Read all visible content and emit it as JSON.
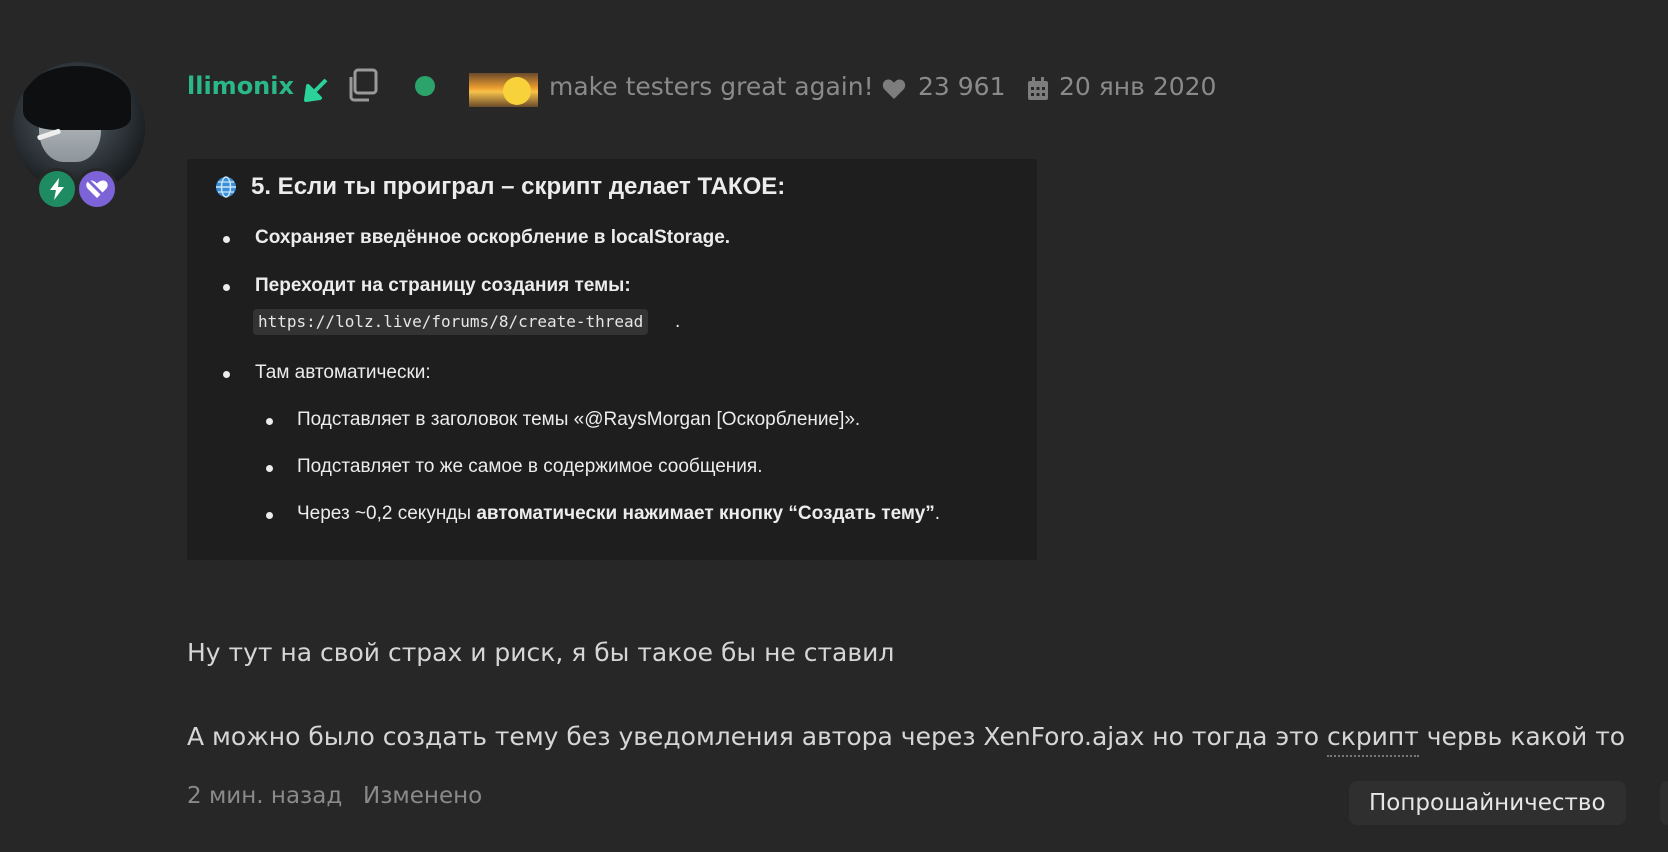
{
  "post": {
    "username": "llimonix",
    "status_text": "make testers great again!",
    "likes": "23 961",
    "registered": "20 янв 2020",
    "screenshot": {
      "heading": "5. Если ты проиграл – скрипт делает ТАКОЕ:",
      "bullet1": "Сохраняет введённое оскорбление в localStorage.",
      "bullet2": "Переходит на страницу создания темы:",
      "code": "https://lolz.live/forums/8/create-thread",
      "code_suffix": ".",
      "bullet3": "Там автоматически:",
      "sub1": "Подставляет в заголовок темы «@RaysMorgan [Оскорбление]».",
      "sub2": "Подставляет то же самое в содержимое сообщения.",
      "sub3_prefix": "Через ~0,2 секунды ",
      "sub3_bold": "автоматически нажимает кнопку “Создать тему”",
      "sub3_suffix": "."
    },
    "paragraph1": "Ну тут на свой страх и риск, я бы такое бы не ставил",
    "paragraph2_before": "А можно было создать тему без уведомления автора через XenForo.ajax но тогда это ",
    "paragraph2_tip": "скрипт",
    "paragraph2_after": " червь какой то",
    "time_ago": "2 мин. назад",
    "edited": "Изменено",
    "tag": "Попрошайничество"
  },
  "icons": {
    "badge1": "lightning-icon",
    "badge2": "heart-off-icon",
    "arrow": "arrow-down-left-icon",
    "copy": "copy-icon",
    "online": "online-dot",
    "heart": "heart-icon",
    "calendar": "calendar-icon",
    "globe": "globe-icon"
  },
  "colors": {
    "background": "#272727",
    "username": "#2bb888",
    "muted": "#8a8a8a",
    "online": "#2ba36b",
    "badge_green": "#1f8b63",
    "badge_purple": "#7c63d8"
  }
}
